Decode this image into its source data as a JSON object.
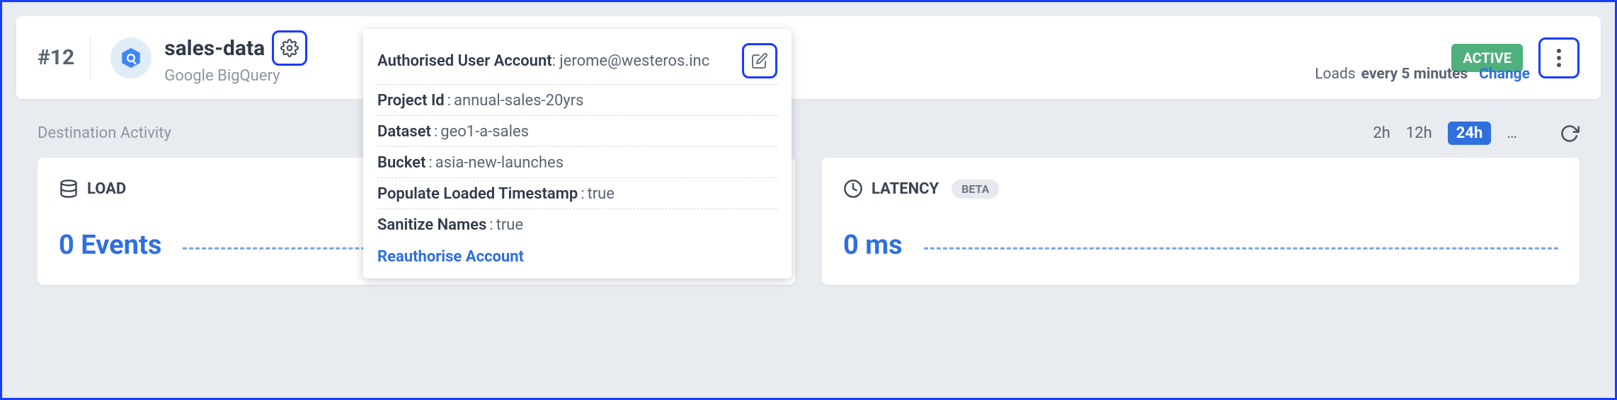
{
  "header": {
    "id": "#12",
    "title": "sales-data",
    "subtitle": "Google BigQuery",
    "status": "ACTIVE",
    "loads_prefix": "Loads ",
    "loads_interval": "every 5 minutes",
    "change_label": "Change"
  },
  "popup": {
    "rows": [
      {
        "label": "Authorised User Account",
        "value": "jerome@westeros.inc"
      },
      {
        "label": "Project Id",
        "value": "annual-sales-20yrs"
      },
      {
        "label": "Dataset",
        "value": "geo1-a-sales"
      },
      {
        "label": "Bucket",
        "value": "asia-new-launches"
      },
      {
        "label": "Populate Loaded Timestamp",
        "value": "true"
      },
      {
        "label": "Sanitize Names",
        "value": "true"
      }
    ],
    "reauth": "Reauthorise Account"
  },
  "activity": {
    "title": "Destination Activity",
    "tabs": [
      "2h",
      "12h",
      "24h",
      "…"
    ],
    "active_index": 2
  },
  "cards": {
    "load": {
      "title": "LOAD",
      "value": "0 Events"
    },
    "latency": {
      "title": "LATENCY",
      "badge": "BETA",
      "value": "0 ms"
    }
  }
}
